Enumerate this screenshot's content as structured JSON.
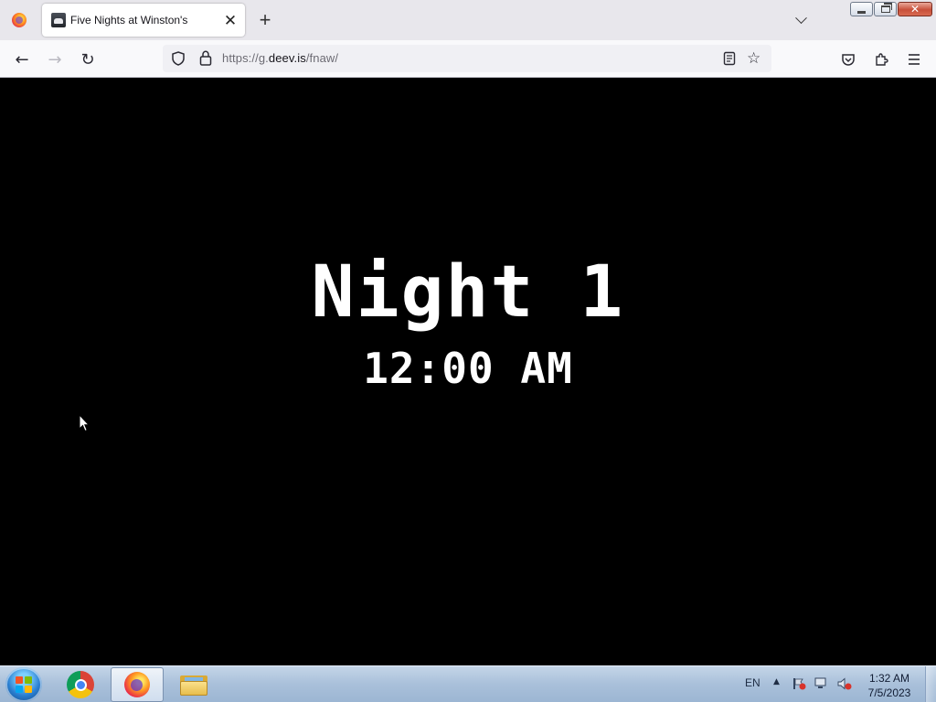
{
  "browser": {
    "tab": {
      "title": "Five Nights at Winston's",
      "close_glyph": "✕"
    },
    "new_tab_glyph": "+",
    "url": {
      "prefix": "https://g.",
      "host": "deev.is",
      "path": "/fnaw/"
    },
    "nav": {
      "back_glyph": "←",
      "forward_glyph": "→",
      "reload_glyph": "↻",
      "star_glyph": "☆"
    }
  },
  "game": {
    "night_label": "Night 1",
    "time_label": "12:00 AM"
  },
  "taskbar": {
    "language": "EN",
    "tray_up_glyph": "▲",
    "clock_time": "1:32 AM",
    "clock_date": "7/5/2023",
    "apps": [
      {
        "name": "chrome-icon"
      },
      {
        "name": "firefox-icon"
      },
      {
        "name": "file-explorer-icon"
      }
    ]
  },
  "colors": {
    "page_background": "#000000",
    "game_text": "#ffffff",
    "taskbar": "#a9c0da"
  }
}
